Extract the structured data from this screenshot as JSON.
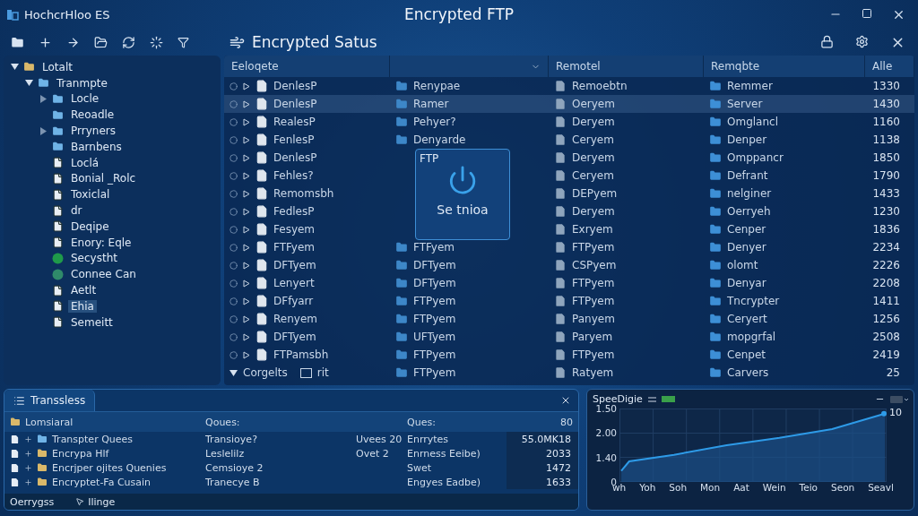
{
  "window": {
    "app_name": "HochcrHloo ES",
    "title": "Encrypted FTP"
  },
  "toolbar": {
    "title": "Encrypted Satus"
  },
  "tree": [
    {
      "label": "Lotalt",
      "kind": "folder",
      "expanded": true,
      "selected": false,
      "children": [
        {
          "label": "Tranmpte",
          "kind": "folder",
          "expanded": true,
          "selected": false,
          "children": [
            {
              "label": "Locle",
              "kind": "folder",
              "expanded": false,
              "selected": false
            },
            {
              "label": "Reoadle",
              "kind": "folder",
              "selected": false
            },
            {
              "label": "Prryners",
              "kind": "folder",
              "expanded": false,
              "selected": false
            },
            {
              "label": "Barnbens",
              "kind": "folder",
              "selected": false
            },
            {
              "label": "Loclá",
              "kind": "file",
              "selected": false
            },
            {
              "label": "Bonial _Rolc",
              "kind": "file",
              "selected": false
            },
            {
              "label": "Toxiclal",
              "kind": "file",
              "selected": false
            },
            {
              "label": "dr",
              "kind": "file",
              "selected": false
            },
            {
              "label": "Deqipe",
              "kind": "file",
              "selected": false
            },
            {
              "label": "Enory: Eqle",
              "kind": "file",
              "selected": false
            },
            {
              "label": "Secystht",
              "kind": "status",
              "color": "#1f9a4a",
              "selected": false
            },
            {
              "label": "Connee Can",
              "kind": "status",
              "color": "#2f8a6a",
              "selected": false
            },
            {
              "label": "Aetlt",
              "kind": "file",
              "selected": false
            },
            {
              "label": "Ehia",
              "kind": "file",
              "selected": true
            },
            {
              "label": "Semeitt",
              "kind": "file",
              "selected": false
            }
          ]
        }
      ]
    }
  ],
  "files": {
    "header": {
      "column_1": "Eeloqete",
      "column_3": "Remotel",
      "column_4": "Remqbte",
      "column_5": "Alle"
    },
    "rows": [
      {
        "kind": "file",
        "name": "DenlesP",
        "column_2": "Renypae",
        "column_3": "Remoebtn",
        "column_4": "Remmer",
        "size": "1330",
        "selected": false
      },
      {
        "kind": "file",
        "name": "DenlesP",
        "column_2": "Ramer",
        "column_3": "Oeryem",
        "column_4": "Server",
        "size": "1430",
        "selected": true
      },
      {
        "kind": "file",
        "name": "RealesP",
        "column_2": "Pehyer?",
        "column_3": "Deryem",
        "column_4": "Omglancl",
        "size": "1160",
        "selected": false
      },
      {
        "kind": "file",
        "name": "FenlesP",
        "column_2": "Denyarde",
        "column_3": "Ceryem",
        "column_4": "Denper",
        "size": "1138",
        "selected": false
      },
      {
        "kind": "file",
        "name": "DenlesP",
        "column_3": "Deryem",
        "column_4": "Omppancr",
        "size": "1850",
        "selected": false
      },
      {
        "kind": "file",
        "name": "Fehles?",
        "column_3": "Ceryem",
        "column_4": "Defrant",
        "size": "1790",
        "selected": false
      },
      {
        "kind": "file",
        "name": "Remomsbh",
        "column_3": "DEPyem",
        "column_4": "nelginer",
        "size": "1433",
        "selected": false
      },
      {
        "kind": "file",
        "name": "FedlesP",
        "column_3": "Deryem",
        "column_4": "Oerryeh",
        "size": "1230",
        "selected": false
      },
      {
        "kind": "file",
        "name": "Fesyem",
        "column_3": "Exryem",
        "column_4": "Cenper",
        "size": "1836",
        "selected": false
      },
      {
        "kind": "file",
        "name": "FTFyem",
        "column_2": "FTFyem",
        "column_3": "FTPyem",
        "column_4": "Denyer",
        "size": "2234",
        "selected": false
      },
      {
        "kind": "file",
        "name": "DFTyem",
        "column_2": "DFTyem",
        "column_3": "CSPyem",
        "column_4": "olomt",
        "size": "2226",
        "selected": false
      },
      {
        "kind": "file",
        "name": "Lenyert",
        "column_2": "DFTyem",
        "column_3": "FTPyem",
        "column_4": "Denyar",
        "size": "2208",
        "selected": false
      },
      {
        "kind": "file",
        "name": "DFfyarr",
        "column_2": "FTPyem",
        "column_3": "FTPyem",
        "column_4": "Tncrypter",
        "size": "1411",
        "selected": false
      },
      {
        "kind": "file",
        "name": "Renyem",
        "column_2": "FTPyem",
        "column_3": "Panyem",
        "column_4": "Ceryert",
        "size": "1256",
        "selected": false
      },
      {
        "kind": "file",
        "name": "DFTyem",
        "column_2": "UFTyem",
        "column_3": "Paryem",
        "column_4": "mopgrfal",
        "size": "2508",
        "selected": false
      },
      {
        "kind": "file",
        "name": "FTPamsbh",
        "column_2": "FTPyem",
        "column_3": "FTPyem",
        "column_4": "Cenpet",
        "size": "2419",
        "selected": false
      },
      {
        "kind": "group",
        "name": "Corgelts",
        "check_label": "rit",
        "checked": false,
        "column_2": "FTPyem",
        "column_3": "Ratyem",
        "column_4": "Carvers",
        "size": "25",
        "selected": false
      }
    ]
  },
  "overlay": {
    "title": "FTP",
    "label": "Se tnioa"
  },
  "transfers": {
    "tab": "Transsless",
    "header": [
      "Lomsiaral",
      "Qoues:",
      "Ques:",
      "80"
    ],
    "rows": [
      {
        "name": "Transpter Quees",
        "column_2": "Transioye?",
        "column_3": "Uvees 20",
        "column_4": "Enrrytes",
        "column_5": "55.0MK18"
      },
      {
        "name": "Encrypa Hlf",
        "column_2": "Leslelilz",
        "column_3": "Ovet 2",
        "column_4": "Enrness Eeibe)",
        "column_5": "2033"
      },
      {
        "name": "Encrjper ojites Quenies",
        "column_2": "Cemsioye 2",
        "column_4": "Swet",
        "column_5": "1472"
      },
      {
        "name": "Encryptet-Fa Cusain",
        "column_2": "Tranecye B",
        "column_4": "Engyes Eadbe)",
        "column_5": "1633"
      }
    ],
    "status": [
      "Oerrygss",
      "Ilinge"
    ]
  },
  "speed": {
    "title": "SpeeDigie",
    "end_label": "10",
    "y_labels": [
      "1.50",
      "2.00",
      "1.40",
      "0"
    ],
    "x_labels": [
      "wh",
      "Yoh",
      "Soh",
      "Mon",
      "Aat",
      "Wein",
      "Teio",
      "Seon",
      "Seavl"
    ]
  }
}
